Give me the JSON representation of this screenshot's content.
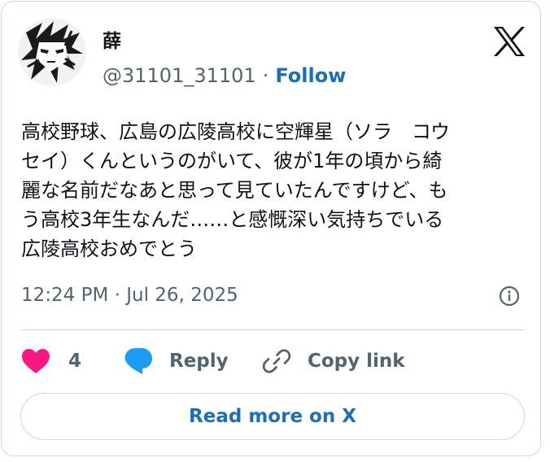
{
  "author": {
    "name": "薛",
    "handle": "@31101_31101",
    "separator": "·",
    "follow_label": "Follow"
  },
  "tweet": {
    "lines": [
      "高校野球、広島の広陵高校に空輝星（ソラ　コウ",
      "セイ）くんというのがいて、彼が1年の頃から綺",
      "麗な名前だなあと思って見ていたんですけど、も",
      "う高校3年生なんだ……と感慨深い気持ちでいる",
      "広陵高校おめでとう"
    ],
    "timestamp": "12:24 PM · Jul 26, 2025"
  },
  "actions": {
    "like_count": "4",
    "reply_label": "Reply",
    "copy_label": "Copy link"
  },
  "footer": {
    "read_more_label": "Read more on X"
  },
  "colors": {
    "like": "#f91880",
    "reply": "#1d9bf0",
    "link": "#1d6fb5",
    "secondary": "#536471",
    "border": "#cfd9de"
  },
  "icons": [
    "avatar-illustration",
    "x-logo-icon",
    "info-icon",
    "heart-icon",
    "reply-bubble-icon",
    "link-icon"
  ]
}
